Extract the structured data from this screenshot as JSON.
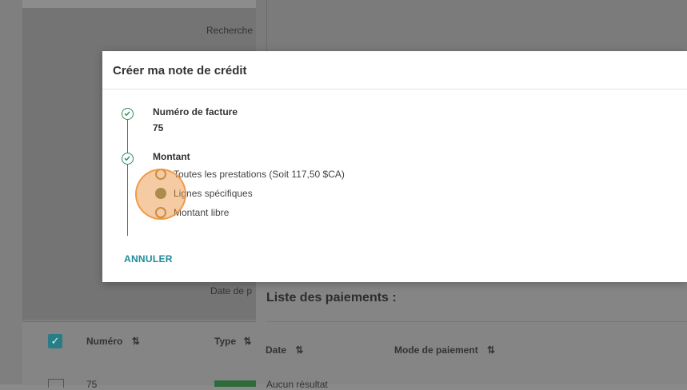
{
  "background": {
    "search_label": "Recherche",
    "date_label": "Date de p",
    "table": {
      "col_number": "Numéro",
      "col_type": "Type",
      "sort_glyph": "⇅",
      "row_number": "75"
    },
    "payments": {
      "title": "Liste des paiements :",
      "col_date": "Date",
      "col_mode": "Mode de paiement",
      "empty": "Aucun résultat"
    }
  },
  "modal": {
    "title": "Créer ma note de crédit",
    "steps": [
      {
        "label": "Numéro de facture",
        "value": "75"
      },
      {
        "label": "Montant"
      }
    ],
    "amount_options": [
      {
        "label": "Toutes les prestations (Soit 117,50 $CA)",
        "selected": false
      },
      {
        "label": "Lignes spécifiques",
        "selected": true
      },
      {
        "label": "Montant libre",
        "selected": false
      }
    ],
    "cancel_label": "ANNULER"
  },
  "colors": {
    "accent_teal": "#1f8a9a",
    "step_green": "#2e8b57",
    "click_highlight": "#f0963c"
  }
}
